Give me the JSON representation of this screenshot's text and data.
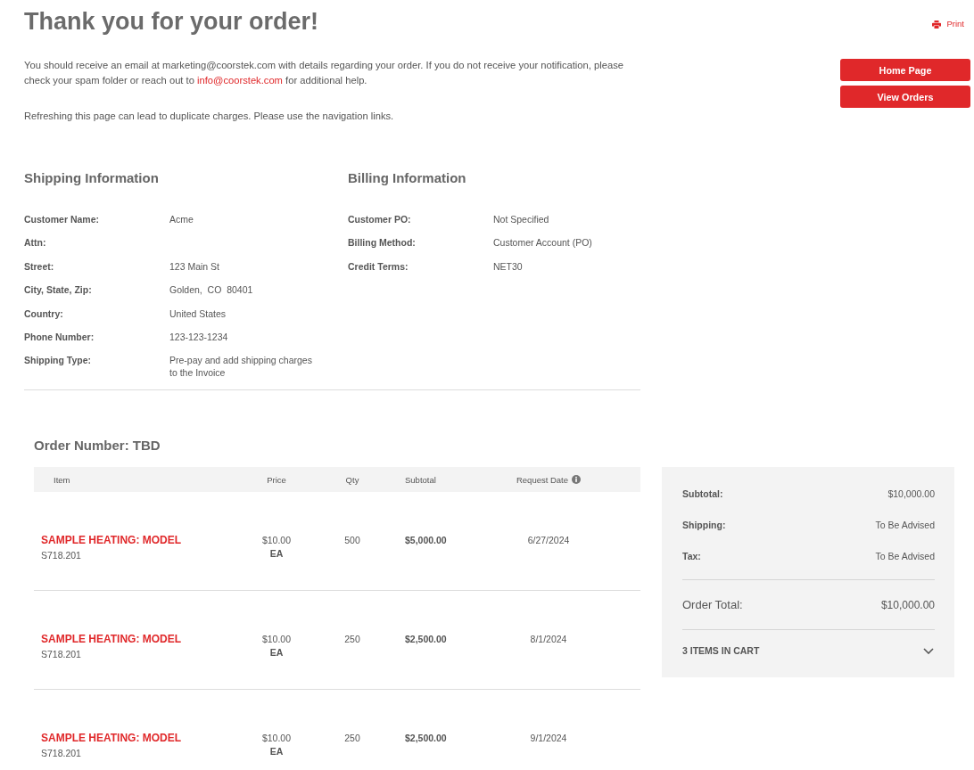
{
  "header": {
    "title": "Thank you for your order!",
    "print_link": "Print"
  },
  "message": {
    "before": "You should receive an email at marketing@coorstek.com with details regarding your order. If you do not receive your notification, please check your spam folder or reach out to",
    "link": "info@coorstek.com",
    "after": "for additional help."
  },
  "notice": "Refreshing this page can lead to duplicate charges. Please use the navigation links.",
  "buttons": [
    "Home Page",
    "View Orders"
  ],
  "shipping": {
    "title": "Shipping Information",
    "fields": [
      {
        "label": "Customer Name:",
        "value": "Acme"
      },
      {
        "label": "Attn:"
      },
      {
        "label": "Street:",
        "value": "123 Main St"
      },
      {
        "label": "City, State, Zip:",
        "value": "Golden,  CO  80401"
      },
      {
        "label": "Country:",
        "value": "United States"
      },
      {
        "label": "Phone Number:",
        "value": "123-123-1234"
      },
      {
        "label": "Shipping Type:",
        "value": "Pre-pay and add shipping charges to the Invoice"
      }
    ]
  },
  "billing": {
    "title": "Billing Information",
    "fields": [
      {
        "label": "Customer PO:",
        "value": "Not Specified"
      },
      {
        "label": "Billing Method:",
        "value": "Customer Account (PO)"
      },
      {
        "label": "Credit Terms:",
        "value": "NET30"
      }
    ]
  },
  "order": {
    "title": "Order Number: TBD",
    "columns": [
      {
        "label": "Item",
        "kind": "plain"
      },
      {
        "label": "Price",
        "kind": "plain"
      },
      {
        "label": "Qty",
        "kind": "plain"
      },
      {
        "label": "Subtotal",
        "kind": "plain"
      },
      {
        "label": "Request Date",
        "kind": "info"
      }
    ],
    "rows": [
      {
        "name": "SAMPLE HEATING: MODEL",
        "sku": "S718.201",
        "price": "$10.00",
        "unit": "EA",
        "qty": "500",
        "subtotal": "$5,000.00",
        "request_date": "6/27/2024"
      },
      {
        "name": "SAMPLE HEATING: MODEL",
        "sku": "S718.201",
        "price": "$10.00",
        "unit": "EA",
        "qty": "250",
        "subtotal": "$2,500.00",
        "request_date": "8/1/2024"
      },
      {
        "name": "SAMPLE HEATING: MODEL",
        "sku": "S718.201",
        "price": "$10.00",
        "unit": "EA",
        "qty": "250",
        "subtotal": "$2,500.00",
        "request_date": "9/1/2024"
      }
    ]
  },
  "summary": {
    "lines": [
      {
        "label": "Subtotal:",
        "value": "$10,000.00"
      },
      {
        "label": "Shipping:",
        "value": "To Be Advised"
      },
      {
        "label": "Tax:",
        "value": "To Be Advised"
      }
    ],
    "total": {
      "label": "Order Total:",
      "value": "$10,000.00"
    },
    "cart": {
      "label": "3 ITEMS IN CART",
      "expanded": false
    }
  }
}
